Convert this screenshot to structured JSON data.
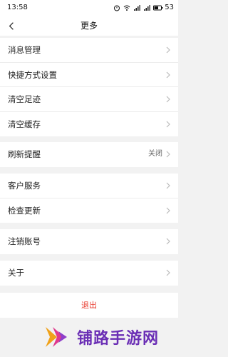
{
  "status_bar": {
    "time": "13:58",
    "battery_percent": "53",
    "icons": [
      "alarm-icon",
      "wifi-icon",
      "signal-icon",
      "signal-icon",
      "battery-icon"
    ]
  },
  "navbar": {
    "title": "更多",
    "back_icon": "back-arrow-icon"
  },
  "groups": [
    {
      "items": [
        {
          "label": "消息管理"
        },
        {
          "label": "快捷方式设置"
        },
        {
          "label": "清空足迹"
        },
        {
          "label": "清空缓存"
        }
      ]
    },
    {
      "items": [
        {
          "label": "刷新提醒",
          "value": "关闭"
        }
      ]
    },
    {
      "items": [
        {
          "label": "客户服务"
        },
        {
          "label": "检查更新"
        }
      ]
    },
    {
      "items": [
        {
          "label": "注销账号"
        }
      ]
    },
    {
      "items": [
        {
          "label": "关于"
        }
      ]
    }
  ],
  "logout_label": "退出",
  "watermark": {
    "text": "铺路手游网",
    "icon": "logo-arrow-icon"
  },
  "colors": {
    "accent": "#e8382b",
    "watermark": "#6b2fb5",
    "background": "#f2f2f2"
  }
}
